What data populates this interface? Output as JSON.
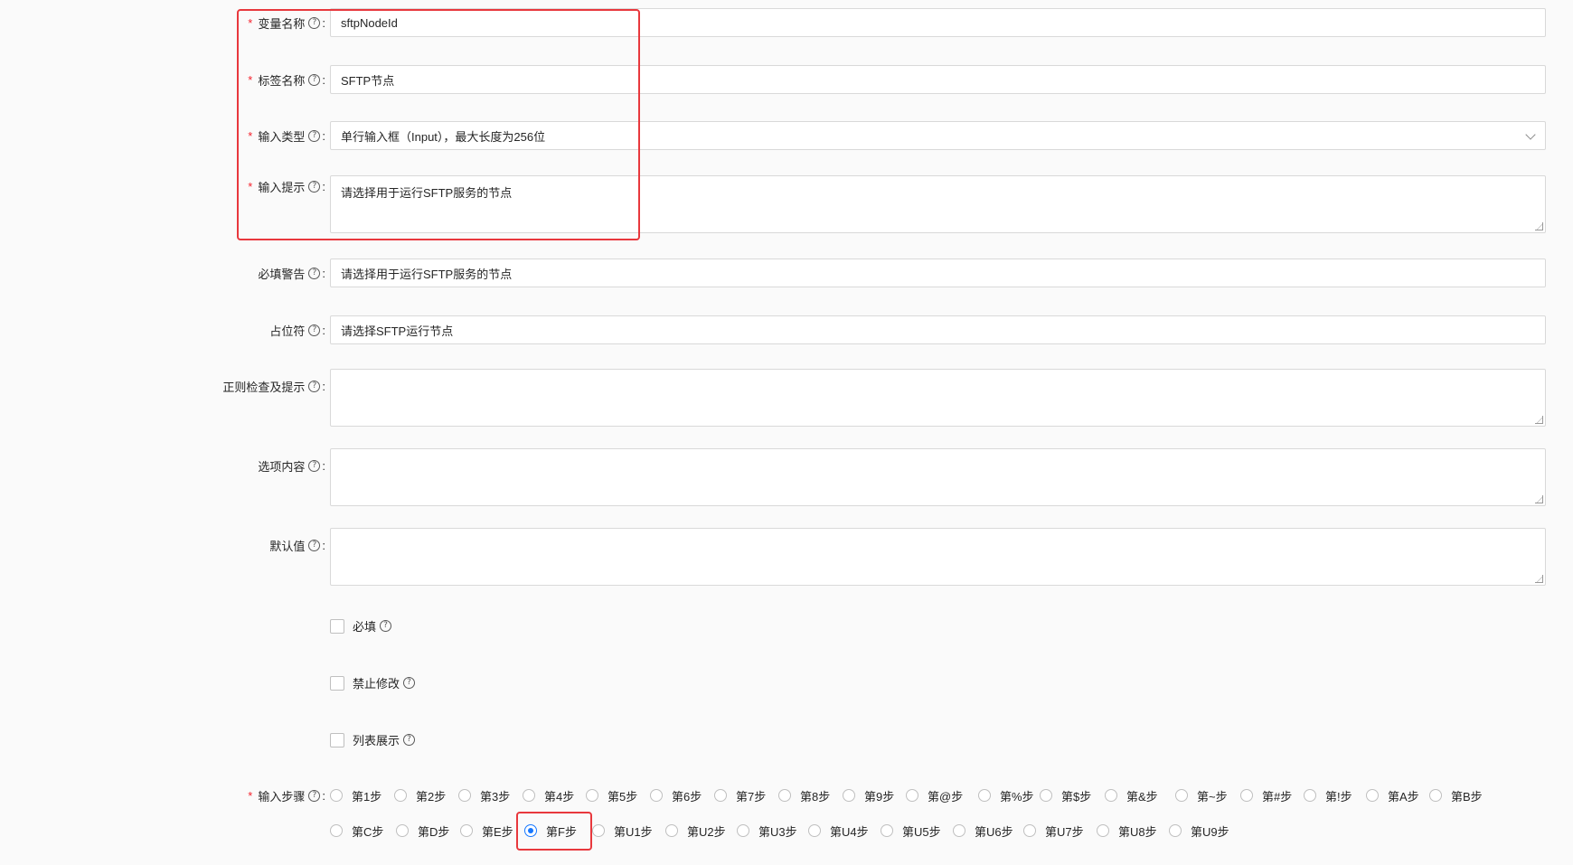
{
  "fields": {
    "variable_name": {
      "label": "变量名称",
      "value": "sftpNodeId"
    },
    "tag_name": {
      "label": "标签名称",
      "value": "SFTP节点"
    },
    "input_type": {
      "label": "输入类型",
      "value": "单行输入框（Input），最大长度为256位"
    },
    "input_hint": {
      "label": "输入提示",
      "value": "请选择用于运行SFTP服务的节点"
    },
    "required_warning": {
      "label": "必填警告",
      "value": "请选择用于运行SFTP服务的节点"
    },
    "placeholder": {
      "label": "占位符",
      "value": "请选择SFTP运行节点"
    },
    "regex_hint": {
      "label": "正则检查及提示",
      "value": ""
    },
    "options": {
      "label": "选项内容",
      "value": ""
    },
    "default_value": {
      "label": "默认值",
      "value": ""
    }
  },
  "checkboxes": [
    {
      "label": "必填",
      "checked": false
    },
    {
      "label": "禁止修改",
      "checked": false
    },
    {
      "label": "列表展示",
      "checked": false
    }
  ],
  "steps": {
    "label": "输入步骤",
    "selected": "第F步",
    "row1": [
      "第1步",
      "第2步",
      "第3步",
      "第4步",
      "第5步",
      "第6步",
      "第7步",
      "第8步",
      "第9步",
      "第@步",
      "第%步",
      "第$步",
      "第&步",
      "第~步",
      "第#步",
      "第!步",
      "第A步",
      "第B步"
    ],
    "row2": [
      "第C步",
      "第D步",
      "第E步",
      "第F步",
      "第U1步",
      "第U2步",
      "第U3步",
      "第U4步",
      "第U5步",
      "第U6步",
      "第U7步",
      "第U8步",
      "第U9步"
    ]
  },
  "icons": {
    "help": "question-circle-icon",
    "select_arrow": "chevron-down-icon"
  },
  "colors": {
    "required_mark": "#f5222d",
    "radio_selected": "#1677ff",
    "highlight_box": "#e8383d"
  }
}
